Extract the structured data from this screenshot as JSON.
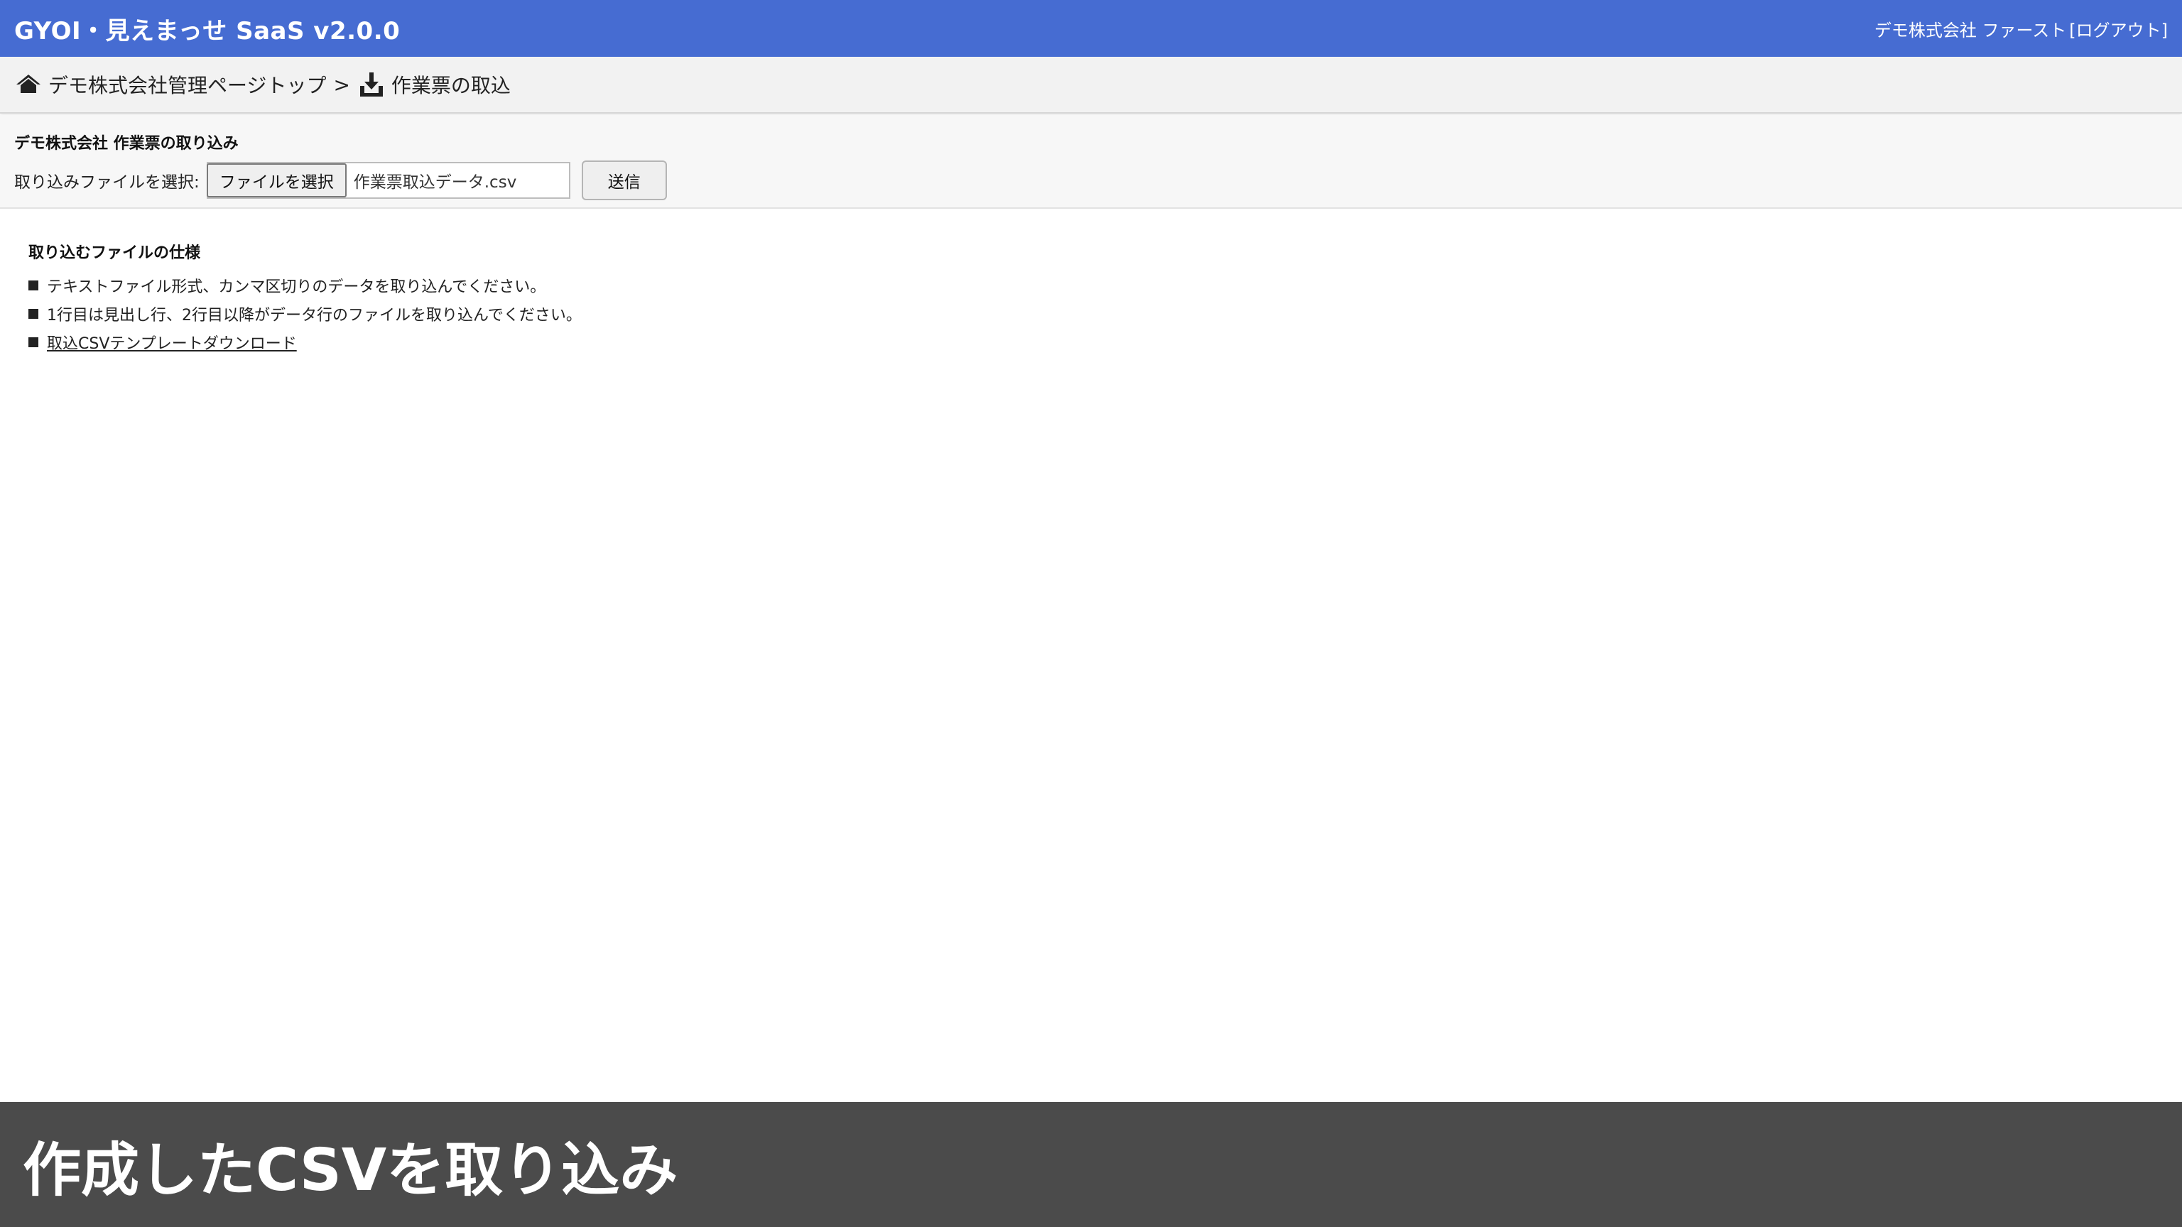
{
  "header": {
    "app_title": "GYOI・見えまっせ SaaS v2.0.0",
    "company_user": "デモ株式会社 ファースト",
    "logout_label": "[ログアウト]",
    "brand_color": "#466cd2"
  },
  "breadcrumb": {
    "home_icon": "home-icon",
    "home_label": "デモ株式会社管理ページトップ",
    "separator": ">",
    "current_icon": "download-icon",
    "current_label": "作業票の取込"
  },
  "import_form": {
    "title": "デモ株式会社 作業票の取り込み",
    "select_label": "取り込みファイルを選択:",
    "file_button_label": "ファイルを選択",
    "selected_file": "作業票取込データ.csv",
    "submit_label": "送信"
  },
  "spec": {
    "title": "取り込むファイルの仕様",
    "items": [
      "テキストファイル形式、カンマ区切りのデータを取り込んでください。",
      "1行目は見出し行、2行目以降がデータ行のファイルを取り込んでください。"
    ],
    "template_link": "取込CSVテンプレートダウンロード"
  },
  "caption": {
    "text": "作成したCSVを取り込み"
  }
}
